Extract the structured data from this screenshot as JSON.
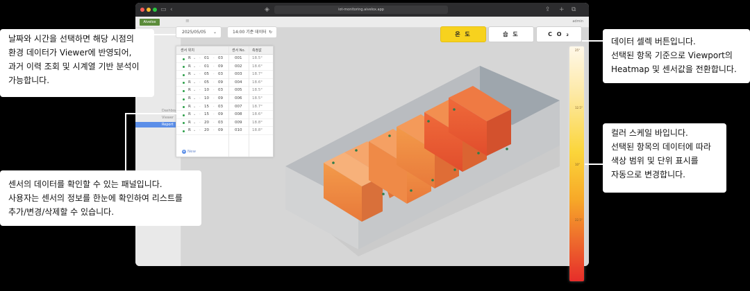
{
  "browser": {
    "url": "iot-monitoring.aivelox.app"
  },
  "app": {
    "logo": "Aivelox",
    "user": "admin"
  },
  "sidebar": {
    "items": [
      "Dashboard",
      "Viewer",
      "Report"
    ],
    "active_index": 1
  },
  "controls": {
    "date": "2025/05/05",
    "time": "14:00 기준 데이터",
    "metrics": [
      "온 도",
      "습 도",
      "C O ₂"
    ],
    "selected_metric": "온 도"
  },
  "sensor_table": {
    "headers": [
      "센서 위치",
      "센서 No.",
      "측정값"
    ],
    "rows": [
      {
        "r": "R",
        "a": "01",
        "b": "03",
        "no": "001",
        "value": "18.5°"
      },
      {
        "r": "R",
        "a": "01",
        "b": "09",
        "no": "002",
        "value": "18.6°"
      },
      {
        "r": "R",
        "a": "05",
        "b": "03",
        "no": "003",
        "value": "18.7°"
      },
      {
        "r": "R",
        "a": "05",
        "b": "09",
        "no": "004",
        "value": "18.6°"
      },
      {
        "r": "R",
        "a": "10",
        "b": "03",
        "no": "005",
        "value": "18.5°"
      },
      {
        "r": "R",
        "a": "10",
        "b": "09",
        "no": "006",
        "value": "18.5°"
      },
      {
        "r": "R",
        "a": "15",
        "b": "03",
        "no": "007",
        "value": "18.7°"
      },
      {
        "r": "R",
        "a": "15",
        "b": "09",
        "no": "008",
        "value": "18.6°"
      },
      {
        "r": "R",
        "a": "20",
        "b": "03",
        "no": "009",
        "value": "18.8°"
      },
      {
        "r": "R",
        "a": "20",
        "b": "09",
        "no": "010",
        "value": "18.8°"
      }
    ],
    "add_label": "New"
  },
  "color_scale": {
    "labels": [
      "25°",
      "12.5°",
      "10°",
      "22.5°"
    ],
    "colors": {
      "low": "#fff8ea",
      "mid": "#fbd53a",
      "high": "#e62d2a"
    }
  },
  "callouts": {
    "date_time": [
      "날짜와 시간을 선택하면 해당 시점의",
      "환경 데이터가 Viewer에 반영되어,",
      "과거 이력 조회 및 시계열 기반 분석이",
      "가능합니다."
    ],
    "sensor_panel": [
      "센서의 데이터를 확인할 수 있는 패널입니다.",
      "사용자는 센서의 정보를 한눈에 확인하여 리스트를",
      "추가/변경/삭제할 수 있습니다."
    ],
    "data_select": [
      "데이터 셀렉 버튼입니다.",
      "선택된 항목 기준으로 Viewport의",
      "Heatmap 및 센서값을 전환합니다."
    ],
    "color_scale": [
      "컬러 스케일 바입니다.",
      "선택된 항목의 데이터에 따라",
      "색상 범위 및 단위 표시를",
      "자동으로 변경합니다."
    ]
  },
  "accent_colors": {
    "selected": "#f7d21e",
    "sensor_dot": "#2e9f4a",
    "sidebar_active": "#5b8ee8"
  }
}
